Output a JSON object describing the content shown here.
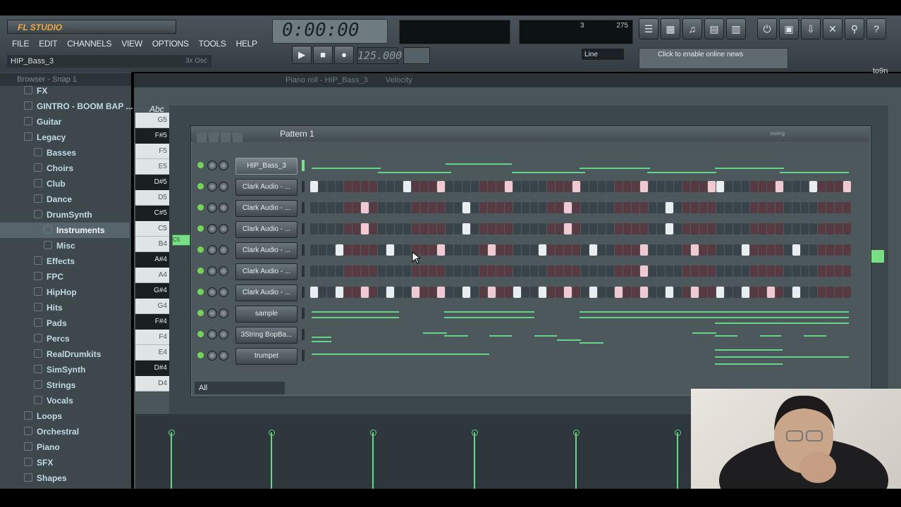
{
  "app": {
    "logo": "FL STUDIO",
    "hint": "HIP_Bass_3",
    "hint_right": "3x Osc"
  },
  "menu": [
    "FILE",
    "EDIT",
    "CHANNELS",
    "VIEW",
    "OPTIONS",
    "TOOLS",
    "HELP"
  ],
  "transport": {
    "time": "0:00:00",
    "tempo": "125.000",
    "line_mode": "Line",
    "news": "Click to enable online news",
    "cpu_left": "3",
    "cpu_right": "275"
  },
  "browser": {
    "title": "Browser - Snap 1",
    "items": [
      {
        "label": "FX",
        "indent": 1
      },
      {
        "label": "GINTRO - BOOM BAP ...",
        "indent": 1
      },
      {
        "label": "Guitar",
        "indent": 1
      },
      {
        "label": "Legacy",
        "indent": 1
      },
      {
        "label": "Basses",
        "indent": 2
      },
      {
        "label": "Choirs",
        "indent": 2
      },
      {
        "label": "Club",
        "indent": 2
      },
      {
        "label": "Dance",
        "indent": 2
      },
      {
        "label": "DrumSynth",
        "indent": 2
      },
      {
        "label": "Instruments",
        "indent": 3,
        "selected": true
      },
      {
        "label": "Misc",
        "indent": 3
      },
      {
        "label": "Effects",
        "indent": 2
      },
      {
        "label": "FPC",
        "indent": 2
      },
      {
        "label": "HipHop",
        "indent": 2
      },
      {
        "label": "Hits",
        "indent": 2
      },
      {
        "label": "Pads",
        "indent": 2
      },
      {
        "label": "Percs",
        "indent": 2
      },
      {
        "label": "RealDrumkits",
        "indent": 2
      },
      {
        "label": "SimSynth",
        "indent": 2
      },
      {
        "label": "Strings",
        "indent": 2
      },
      {
        "label": "Vocals",
        "indent": 2
      },
      {
        "label": "Loops",
        "indent": 1
      },
      {
        "label": "Orchestral",
        "indent": 1
      },
      {
        "label": "Piano",
        "indent": 1
      },
      {
        "label": "SFX",
        "indent": 1
      },
      {
        "label": "Shapes",
        "indent": 1
      }
    ]
  },
  "piano_roll": {
    "title": "Piano roll - HIP_Bass_3",
    "title_suffix": "Velocity",
    "tag": "Abc",
    "keys": [
      "G5",
      "F#5",
      "F5",
      "E5",
      "D#5",
      "D5",
      "C#5",
      "C5",
      "B4",
      "A#4",
      "A4",
      "G#4",
      "G4",
      "F#4",
      "F4",
      "E4",
      "D#4",
      "D4"
    ],
    "note_label": "C5",
    "extra_label": "to9n"
  },
  "sequencer": {
    "title": "Pattern 1",
    "swing_label": "swing",
    "filter": "All",
    "channels": [
      {
        "name": "HIP_Bass_3",
        "type": "roll",
        "selected": true
      },
      {
        "name": "Clark Audio - ...",
        "type": "steps",
        "on": [
          0,
          11,
          15,
          23,
          31,
          39,
          47,
          48,
          55,
          59,
          63,
          71
        ]
      },
      {
        "name": "Clark Audio - ...",
        "type": "steps",
        "on": [
          6,
          18,
          30,
          42
        ]
      },
      {
        "name": "Clark Audio - ...",
        "type": "steps",
        "on": [
          6,
          18,
          30,
          42
        ]
      },
      {
        "name": "Clark Audio - ...",
        "type": "steps",
        "on": [
          3,
          9,
          15,
          21,
          27,
          33,
          39,
          45,
          51,
          57
        ]
      },
      {
        "name": "Clark Audio - ...",
        "type": "steps",
        "on": [
          39
        ]
      },
      {
        "name": "Clark Audio - ...",
        "type": "steps",
        "on": [
          0,
          3,
          6,
          9,
          12,
          15,
          18,
          21,
          24,
          27,
          30,
          33,
          36,
          39,
          42,
          45,
          48,
          51,
          54,
          57
        ]
      },
      {
        "name": "sample",
        "type": "roll"
      },
      {
        "name": "3String BopBa...",
        "type": "roll"
      },
      {
        "name": "trumpet",
        "type": "roll"
      }
    ]
  }
}
